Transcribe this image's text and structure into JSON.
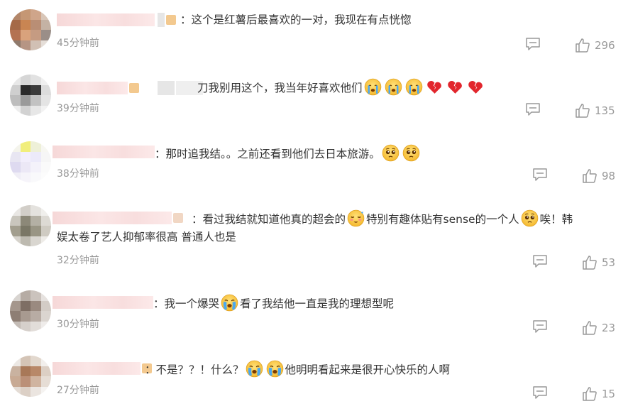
{
  "comments": [
    {
      "text": "：这个是红薯后最喜欢的一对，我现在有点恍惚",
      "time": "45分钟前",
      "likes": "296"
    },
    {
      "text": "刀我别用这个，我当年好喜欢他们",
      "time": "39分钟前",
      "likes": "135",
      "emojis": [
        "crying-emoji",
        "crying-emoji",
        "crying-emoji",
        "broken-heart-emoji",
        "broken-heart-emoji",
        "broken-heart-emoji"
      ]
    },
    {
      "text": "：那时追我结。。之前还看到他们去日本旅游。",
      "time": "38分钟前",
      "likes": "98",
      "emojis": [
        "pleading-emoji",
        "pleading-emoji"
      ]
    },
    {
      "text_a": "：看过我结就知道他真的超会的",
      "text_b": "特别有趣体贴有sense的一个人",
      "text_c": "唉！韩",
      "text_line2": "娱太卷了艺人抑郁率很高 普通人也是",
      "time": "32分钟前",
      "likes": "53",
      "emojis": [
        "blushing-emoji",
        "pleading-emoji"
      ]
    },
    {
      "text_a": "：我一个爆哭",
      "text_b": "看了我结他一直是我的理想型呢",
      "time": "30分钟前",
      "likes": "23",
      "emojis": [
        "loudly-crying-emoji"
      ]
    },
    {
      "text_a": "：不是？？！什么？",
      "text_b": "他明明看起来是很开心快乐的人啊",
      "time": "27分钟前",
      "likes": "15",
      "emojis": [
        "loudly-crying-emoji",
        "loudly-crying-emoji"
      ]
    }
  ],
  "colors": {
    "text": "#333333",
    "meta": "#999999",
    "background": "#ffffff"
  },
  "icons": {
    "reply": "comment-bubble-icon",
    "like": "thumbs-up-icon"
  }
}
